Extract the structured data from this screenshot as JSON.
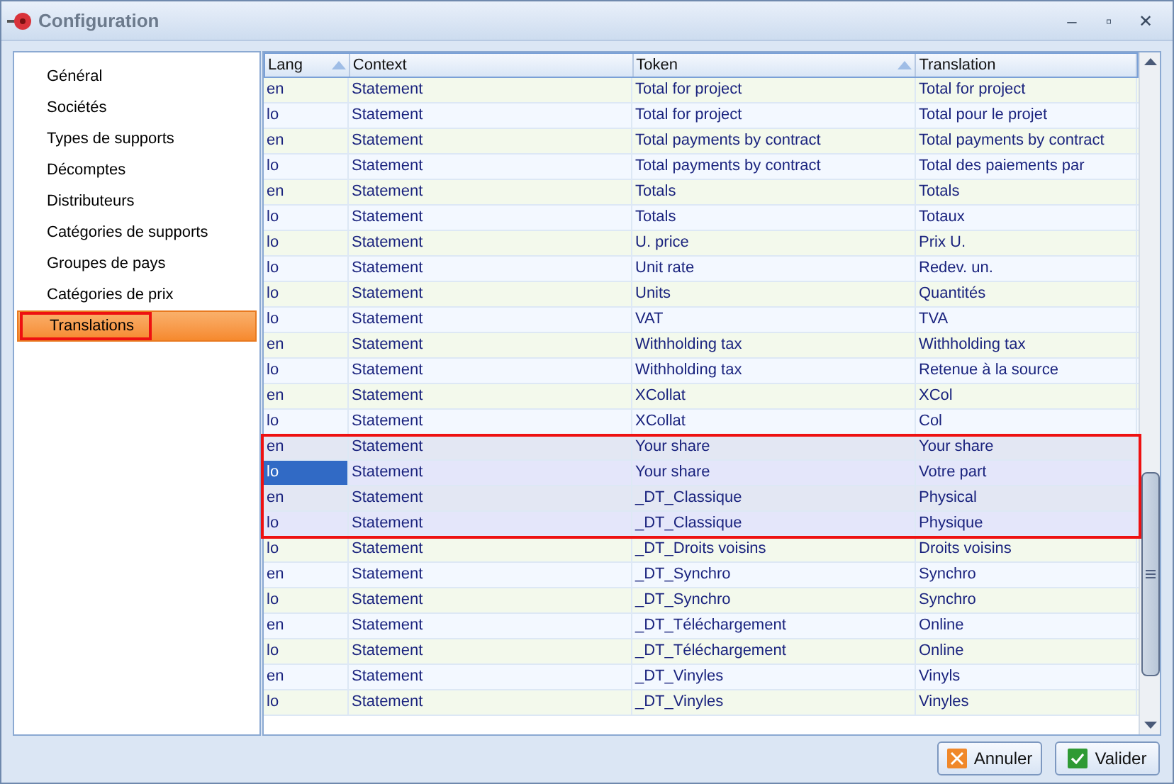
{
  "window": {
    "title": "Configuration",
    "controls": [
      "–",
      "▫",
      "✕"
    ]
  },
  "sidebar": {
    "items": [
      {
        "label": "Général",
        "selected": false
      },
      {
        "label": "Sociétés",
        "selected": false
      },
      {
        "label": "Types de supports",
        "selected": false
      },
      {
        "label": "Décomptes",
        "selected": false
      },
      {
        "label": "Distributeurs",
        "selected": false
      },
      {
        "label": "Catégories de supports",
        "selected": false
      },
      {
        "label": "Groupes de pays",
        "selected": false
      },
      {
        "label": "Catégories de prix",
        "selected": false
      },
      {
        "label": "Translations",
        "selected": true
      }
    ]
  },
  "table": {
    "columns": [
      {
        "label": "Lang",
        "sorted": true
      },
      {
        "label": "Context",
        "sorted": false
      },
      {
        "label": "Token",
        "sorted": true
      },
      {
        "label": "Translation",
        "sorted": false
      }
    ],
    "rows": [
      {
        "cells": [
          "en",
          "Statement",
          "Total for project",
          "Total for project"
        ],
        "selected": false,
        "focused": false
      },
      {
        "cells": [
          "lo",
          "Statement",
          "Total for project",
          "Total pour le projet"
        ],
        "selected": false,
        "focused": false
      },
      {
        "cells": [
          "en",
          "Statement",
          "Total payments by contract",
          "Total payments by contract"
        ],
        "selected": false,
        "focused": false
      },
      {
        "cells": [
          "lo",
          "Statement",
          "Total payments by contract",
          "Total des paiements par"
        ],
        "selected": false,
        "focused": false
      },
      {
        "cells": [
          "en",
          "Statement",
          "Totals",
          "Totals"
        ],
        "selected": false,
        "focused": false
      },
      {
        "cells": [
          "lo",
          "Statement",
          "Totals",
          "Totaux"
        ],
        "selected": false,
        "focused": false
      },
      {
        "cells": [
          "lo",
          "Statement",
          "U. price",
          "Prix U."
        ],
        "selected": false,
        "focused": false
      },
      {
        "cells": [
          "lo",
          "Statement",
          "Unit rate",
          "Redev. un."
        ],
        "selected": false,
        "focused": false
      },
      {
        "cells": [
          "lo",
          "Statement",
          "Units",
          "Quantités"
        ],
        "selected": false,
        "focused": false
      },
      {
        "cells": [
          "lo",
          "Statement",
          "VAT",
          "TVA"
        ],
        "selected": false,
        "focused": false
      },
      {
        "cells": [
          "en",
          "Statement",
          "Withholding tax",
          "Withholding tax"
        ],
        "selected": false,
        "focused": false
      },
      {
        "cells": [
          "lo",
          "Statement",
          "Withholding tax",
          "Retenue à la source"
        ],
        "selected": false,
        "focused": false
      },
      {
        "cells": [
          "en",
          "Statement",
          "XCollat",
          "XCol"
        ],
        "selected": false,
        "focused": false
      },
      {
        "cells": [
          "lo",
          "Statement",
          "XCollat",
          "Col"
        ],
        "selected": false,
        "focused": false
      },
      {
        "cells": [
          "en",
          "Statement",
          "Your share",
          "Your share"
        ],
        "selected": true,
        "focused": false
      },
      {
        "cells": [
          "lo",
          "Statement",
          "Your share",
          "Votre part"
        ],
        "selected": true,
        "focused": true
      },
      {
        "cells": [
          "en",
          "Statement",
          "_DT_Classique",
          "Physical"
        ],
        "selected": true,
        "focused": false
      },
      {
        "cells": [
          "lo",
          "Statement",
          "_DT_Classique",
          "Physique"
        ],
        "selected": true,
        "focused": false
      },
      {
        "cells": [
          "lo",
          "Statement",
          "_DT_Droits voisins",
          "Droits voisins"
        ],
        "selected": false,
        "focused": false
      },
      {
        "cells": [
          "en",
          "Statement",
          "_DT_Synchro",
          "Synchro"
        ],
        "selected": false,
        "focused": false
      },
      {
        "cells": [
          "lo",
          "Statement",
          "_DT_Synchro",
          "Synchro"
        ],
        "selected": false,
        "focused": false
      },
      {
        "cells": [
          "en",
          "Statement",
          "_DT_Téléchargement",
          "Online"
        ],
        "selected": false,
        "focused": false
      },
      {
        "cells": [
          "lo",
          "Statement",
          "_DT_Téléchargement",
          "Online"
        ],
        "selected": false,
        "focused": false
      },
      {
        "cells": [
          "en",
          "Statement",
          "_DT_Vinyles",
          "Vinyls"
        ],
        "selected": false,
        "focused": false
      },
      {
        "cells": [
          "lo",
          "Statement",
          "_DT_Vinyles",
          "Vinyles"
        ],
        "selected": false,
        "focused": false
      }
    ]
  },
  "buttons": [
    {
      "label": "Annuler",
      "kind": "cancel"
    },
    {
      "label": "Valider",
      "kind": "ok"
    }
  ]
}
